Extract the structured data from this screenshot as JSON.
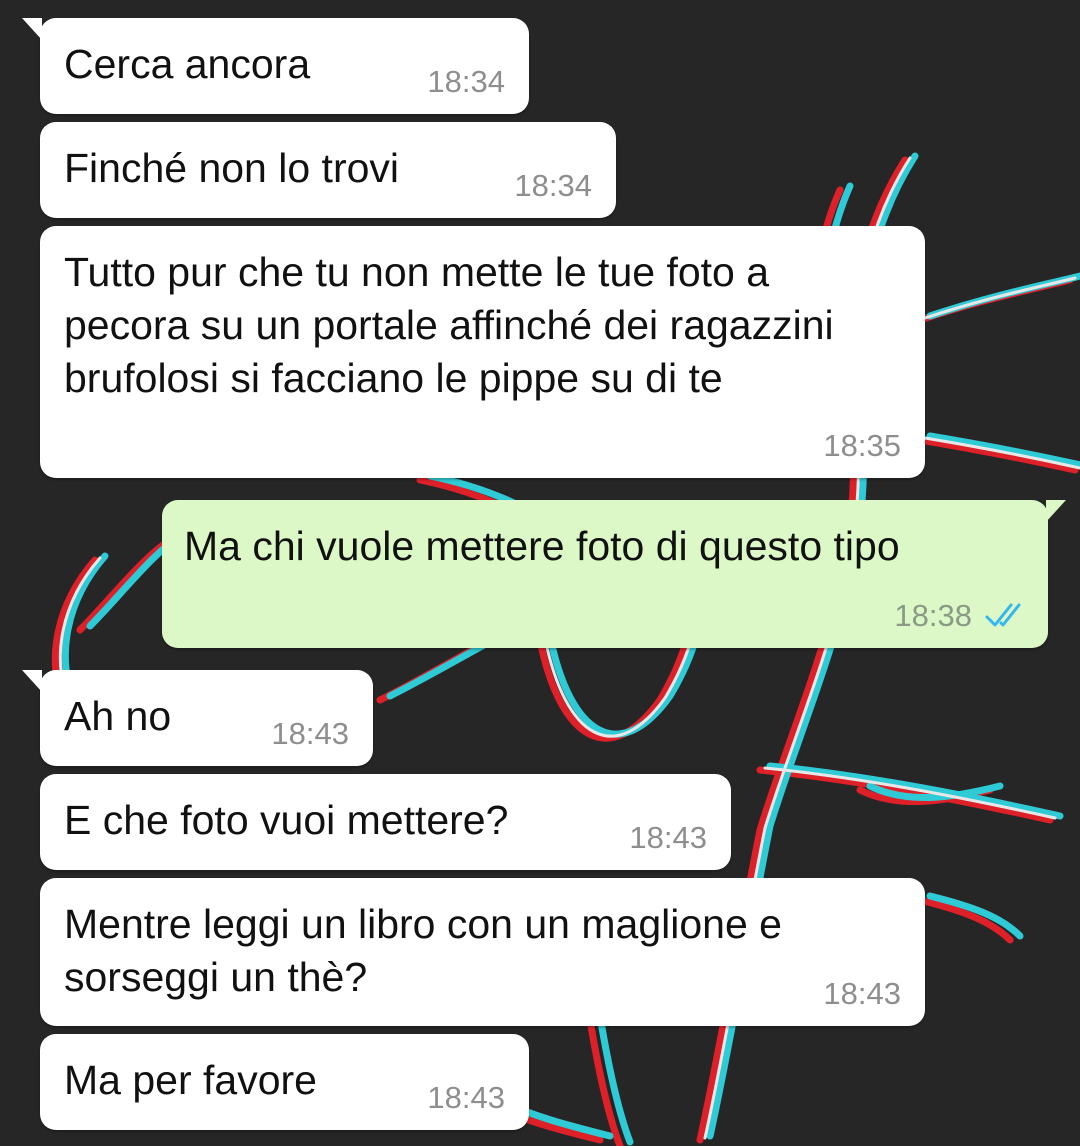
{
  "messages": [
    {
      "text": "Cerca ancora",
      "time": "18:34"
    },
    {
      "text": "Finché non lo trovi",
      "time": "18:34"
    },
    {
      "text": "Tutto pur che tu non mette le tue foto a\npecora su un portale affinché dei ragazzini\nbrufolosi si facciano le pippe su di te",
      "time": "18:35"
    },
    {
      "text": "Ma chi vuole mettere foto di questo tipo",
      "time": "18:38",
      "status": "read-double-check-icon"
    },
    {
      "text": "Ah no",
      "time": "18:43"
    },
    {
      "text": "E che foto vuoi mettere?",
      "time": "18:43"
    },
    {
      "text": "Mentre leggi un libro con un maglione e\nsorseggi un thè?",
      "time": "18:43"
    },
    {
      "text": "Ma per favore",
      "time": "18:43"
    }
  ],
  "colors": {
    "background": "#262626",
    "incoming_bubble": "#ffffff",
    "outgoing_bubble": "#dcf8c6",
    "read_ticks": "#34b7f1",
    "timestamp": "#8e8e8e"
  }
}
